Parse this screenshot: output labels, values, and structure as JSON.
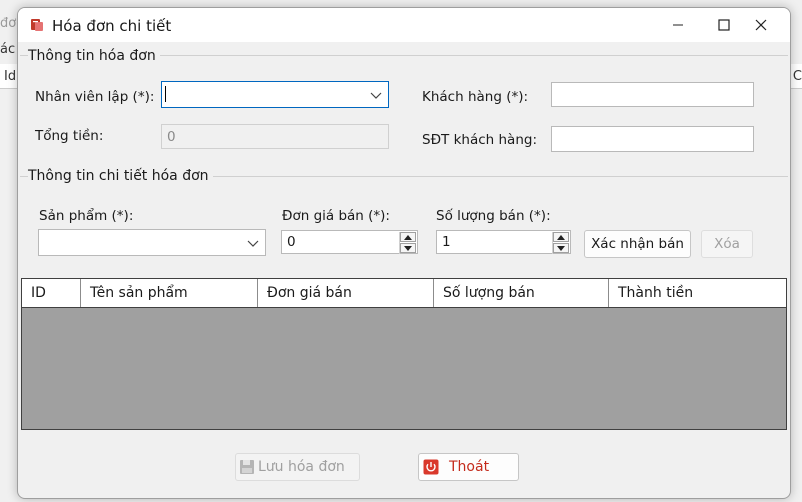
{
  "background": {
    "left_fragments": [
      "đơ",
      "ác",
      "Id"
    ],
    "right_fragments": [
      "C"
    ]
  },
  "window": {
    "title": "Hóa đơn chi tiết",
    "icon": "invoice-app-icon",
    "controls": [
      "minimize-icon",
      "maximize-icon",
      "close-icon"
    ]
  },
  "invoice_info": {
    "section_title": "Thông tin hóa đơn",
    "employee_label": "Nhân viên lập (*):",
    "employee_value": "",
    "customer_label": "Khách hàng (*):",
    "customer_value": "",
    "total_label": "Tổng tiền:",
    "total_value": "0",
    "phone_label": "SĐT khách hàng:",
    "phone_value": ""
  },
  "detail_info": {
    "section_title": "Thông tin chi tiết hóa đơn",
    "product_label": "Sản phẩm (*):",
    "product_value": "",
    "price_label": "Đơn giá bán (*):",
    "price_value": "0",
    "quantity_label": "Số lượng bán (*):",
    "quantity_value": "1",
    "confirm_button": "Xác nhận bán",
    "delete_button": "Xóa"
  },
  "table": {
    "columns": [
      "ID",
      "Tên sản phẩm",
      "Đơn giá bán",
      "Số lượng bán",
      "Thành tiền"
    ],
    "rows": []
  },
  "footer": {
    "save_button": "Lưu hóa đơn",
    "exit_button": "Thoát"
  },
  "colors": {
    "accent": "#0067c0",
    "exit_text": "#c42b1c",
    "grid_bg": "#a0a0a0"
  }
}
